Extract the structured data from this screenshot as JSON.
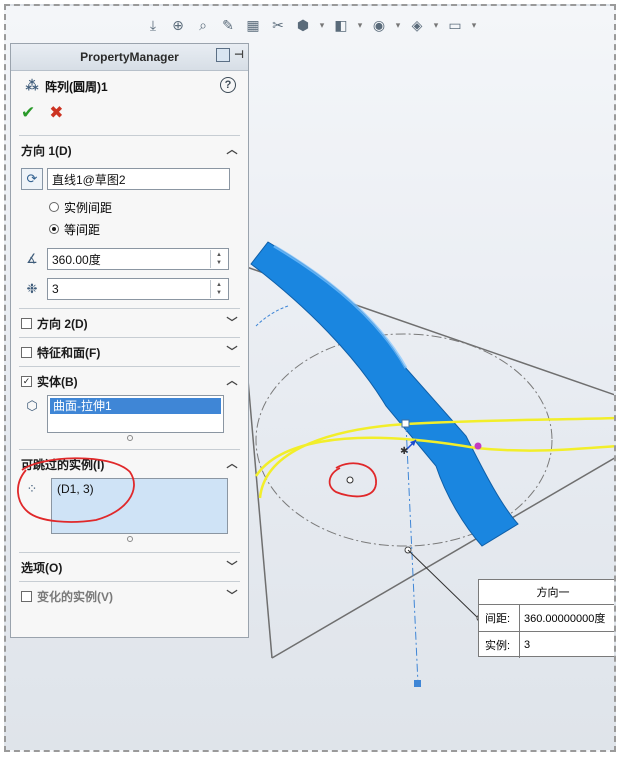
{
  "toolbar": {
    "icons": [
      "view-orient-icon",
      "zoom-fit-icon",
      "zoom-area-icon",
      "previous-view-icon",
      "section-view-icon",
      "dynamic-annotation-icon",
      "display-style-icon",
      "hide-show-icon",
      "edit-appearance-icon",
      "apply-scene-icon",
      "view-settings-icon"
    ]
  },
  "pm": {
    "title": "PropertyManager",
    "feature_name": "阵列(圆周)1",
    "help": "?",
    "ok": "✔",
    "cancel": "✖",
    "direction1": {
      "header": "方向 1(D)",
      "axis_value": "直线1@草图2",
      "option_instance_spacing": "实例间距",
      "option_equal_spacing": "等间距",
      "angle_value": "360.00度",
      "instances_value": "3"
    },
    "direction2": {
      "header": "方向 2(D)"
    },
    "features_faces": {
      "header": "特征和面(F)"
    },
    "bodies": {
      "header": "实体(B)",
      "selected": "曲面-拉伸1"
    },
    "skip_instances": {
      "header": "可跳过的实例(I)",
      "item": "(D1, 3)"
    },
    "options": {
      "header": "选项(O)"
    },
    "vary_instances": {
      "header": "变化的实例(V)"
    }
  },
  "callout": {
    "title": "方向一",
    "spacing_label": "间距:",
    "spacing_value": "360.00000000度",
    "instances_label": "实例:",
    "instances_value": "3"
  },
  "colors": {
    "body_blue": "#1a86e0",
    "highlight_yellow": "#f2ee2a",
    "annotation_red": "#e0282a"
  }
}
